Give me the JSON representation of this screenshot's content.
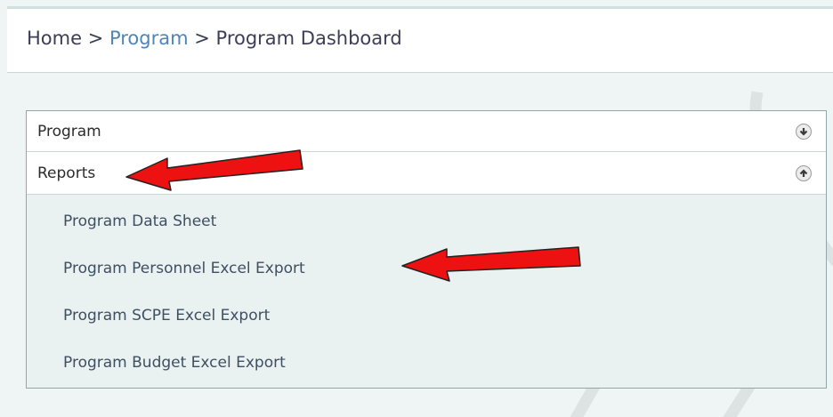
{
  "breadcrumb": {
    "home": "Home",
    "sep1": " > ",
    "program": "Program",
    "sep2": " > ",
    "current": "Program Dashboard"
  },
  "accordion": {
    "sections": [
      {
        "label": "Program",
        "state": "collapsed",
        "icon": "circle-arrow-down-icon"
      },
      {
        "label": "Reports",
        "state": "expanded",
        "icon": "circle-arrow-up-icon"
      }
    ],
    "reports_links": [
      "Program Data Sheet",
      "Program Personnel Excel Export",
      "Program SCPE Excel Export",
      "Program Budget Excel Export"
    ]
  },
  "annotations": {
    "arrow_color": "#ee1111"
  },
  "colors": {
    "link": "#4d86b7",
    "panel_border": "#8fa7a8",
    "watermark": "#dde2e2"
  }
}
